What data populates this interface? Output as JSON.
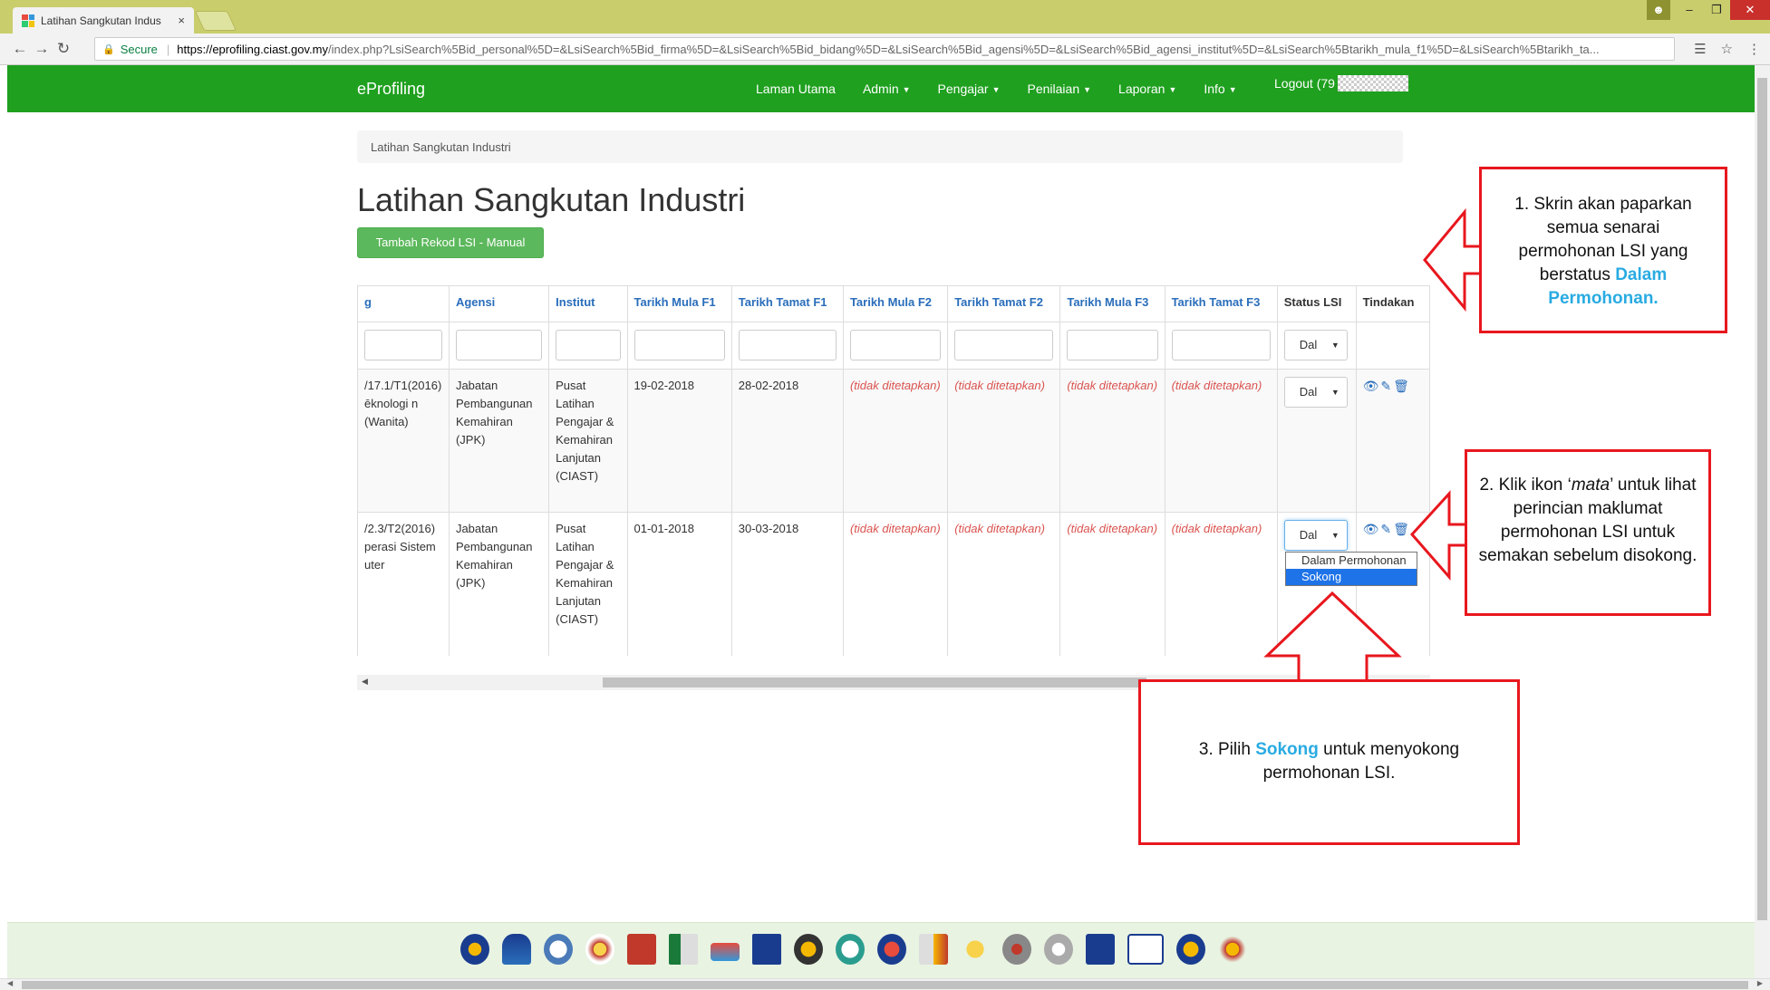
{
  "browser": {
    "tab_title": "Latihan Sangkutan Indus",
    "tab_close": "×",
    "secure_label": "Secure",
    "url_host": "https://eprofiling.ciast.gov.my",
    "url_rest": "/index.php?LsiSearch%5Bid_personal%5D=&LsiSearch%5Bid_firma%5D=&LsiSearch%5Bid_bidang%5D=&LsiSearch%5Bid_agensi%5D=&LsiSearch%5Bid_agensi_institut%5D=&LsiSearch%5Btarikh_mula_f1%5D=&LsiSearch%5Btarikh_ta..."
  },
  "navbar": {
    "brand": "eProfiling",
    "menu": [
      {
        "label": "Laman Utama",
        "caret": false
      },
      {
        "label": "Admin",
        "caret": true
      },
      {
        "label": "Pengajar",
        "caret": true
      },
      {
        "label": "Penilaian",
        "caret": true
      },
      {
        "label": "Laporan",
        "caret": true
      },
      {
        "label": "Info",
        "caret": true
      }
    ],
    "logout": "Logout (79"
  },
  "breadcrumb": "Latihan Sangkutan Industri",
  "page_title": "Latihan Sangkutan Industri",
  "add_button": "Tambah Rekod LSI - Manual",
  "table": {
    "headers": [
      "g",
      "Agensi",
      "Institut",
      "Tarikh Mula F1",
      "Tarikh Tamat F1",
      "Tarikh Mula F2",
      "Tarikh Tamat F2",
      "Tarikh Mula F3",
      "Tarikh Tamat F3",
      "Status LSI",
      "Tindakan"
    ],
    "filter_status": "Dal",
    "rows": [
      {
        "bidang": "/17.1/T1(2016) ēknologi n (Wanita)",
        "agensi": "Jabatan Pembangunan Kemahiran (JPK)",
        "institut": "Pusat Latihan Pengajar & Kemahiran Lanjutan (CIAST)",
        "mula_f1": "19-02-2018",
        "tamat_f1": "28-02-2018",
        "mula_f2": "(tidak ditetapkan)",
        "tamat_f2": "(tidak ditetapkan)",
        "mula_f3": "(tidak ditetapkan)",
        "tamat_f3": "(tidak ditetapkan)",
        "status": "Dal"
      },
      {
        "bidang": "/2.3/T2(2016) perasi Sistem uter",
        "agensi": "Jabatan Pembangunan Kemahiran (JPK)",
        "institut": "Pusat Latihan Pengajar & Kemahiran Lanjutan (CIAST)",
        "mula_f1": "01-01-2018",
        "tamat_f1": "30-03-2018",
        "mula_f2": "(tidak ditetapkan)",
        "tamat_f2": "(tidak ditetapkan)",
        "mula_f3": "(tidak ditetapkan)",
        "tamat_f3": "(tidak ditetapkan)",
        "status": "Dal"
      }
    ],
    "status_options": [
      "Dalam Permohonan",
      "Sokong"
    ],
    "selected_option": "Sokong"
  },
  "callouts": {
    "c1_text": "1. Skrin akan paparkan semua senarai permohonan LSI yang berstatus ",
    "c1_highlight": "Dalam Permohonan.",
    "c2_pre": "2. Klik ikon ‘",
    "c2_em": "mata",
    "c2_post": "’ untuk lihat perincian maklumat permohonan LSI untuk semakan sebelum disokong.",
    "c3_pre": "3. Pilih ",
    "c3_highlight": "Sokong",
    "c3_post": " untuk menyokong permohonan LSI."
  },
  "colors": {
    "navbar": "#1fa01f",
    "callout_border": "#e8171e",
    "highlight": "#29abe2",
    "link": "#2a6ebb"
  }
}
